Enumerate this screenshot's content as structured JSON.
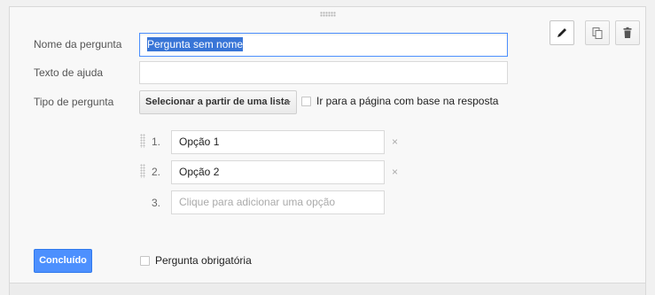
{
  "form": {
    "question_name_label": "Nome da pergunta",
    "question_name_value": "Pergunta sem nome",
    "help_text_label": "Texto de ajuda",
    "help_text_value": "",
    "question_type_label": "Tipo de pergunta",
    "question_type_value": "Selecionar a partir de uma lista",
    "go_to_page_label": "Ir para a página com base na resposta",
    "options": [
      {
        "number": "1.",
        "value": "Opção 1",
        "remove": "×"
      },
      {
        "number": "2.",
        "value": "Opção 2",
        "remove": "×"
      }
    ],
    "add_option": {
      "number": "3.",
      "placeholder": "Clique para adicionar uma opção"
    },
    "done_label": "Concluído",
    "required_label": "Pergunta obrigatória"
  },
  "toolbar": {
    "icons": [
      "pencil-icon",
      "copy-icon",
      "trash-icon"
    ]
  },
  "colors": {
    "primary_button": "#4d90fe",
    "focus_border": "#4d90fe",
    "selection": "#3875d7"
  }
}
